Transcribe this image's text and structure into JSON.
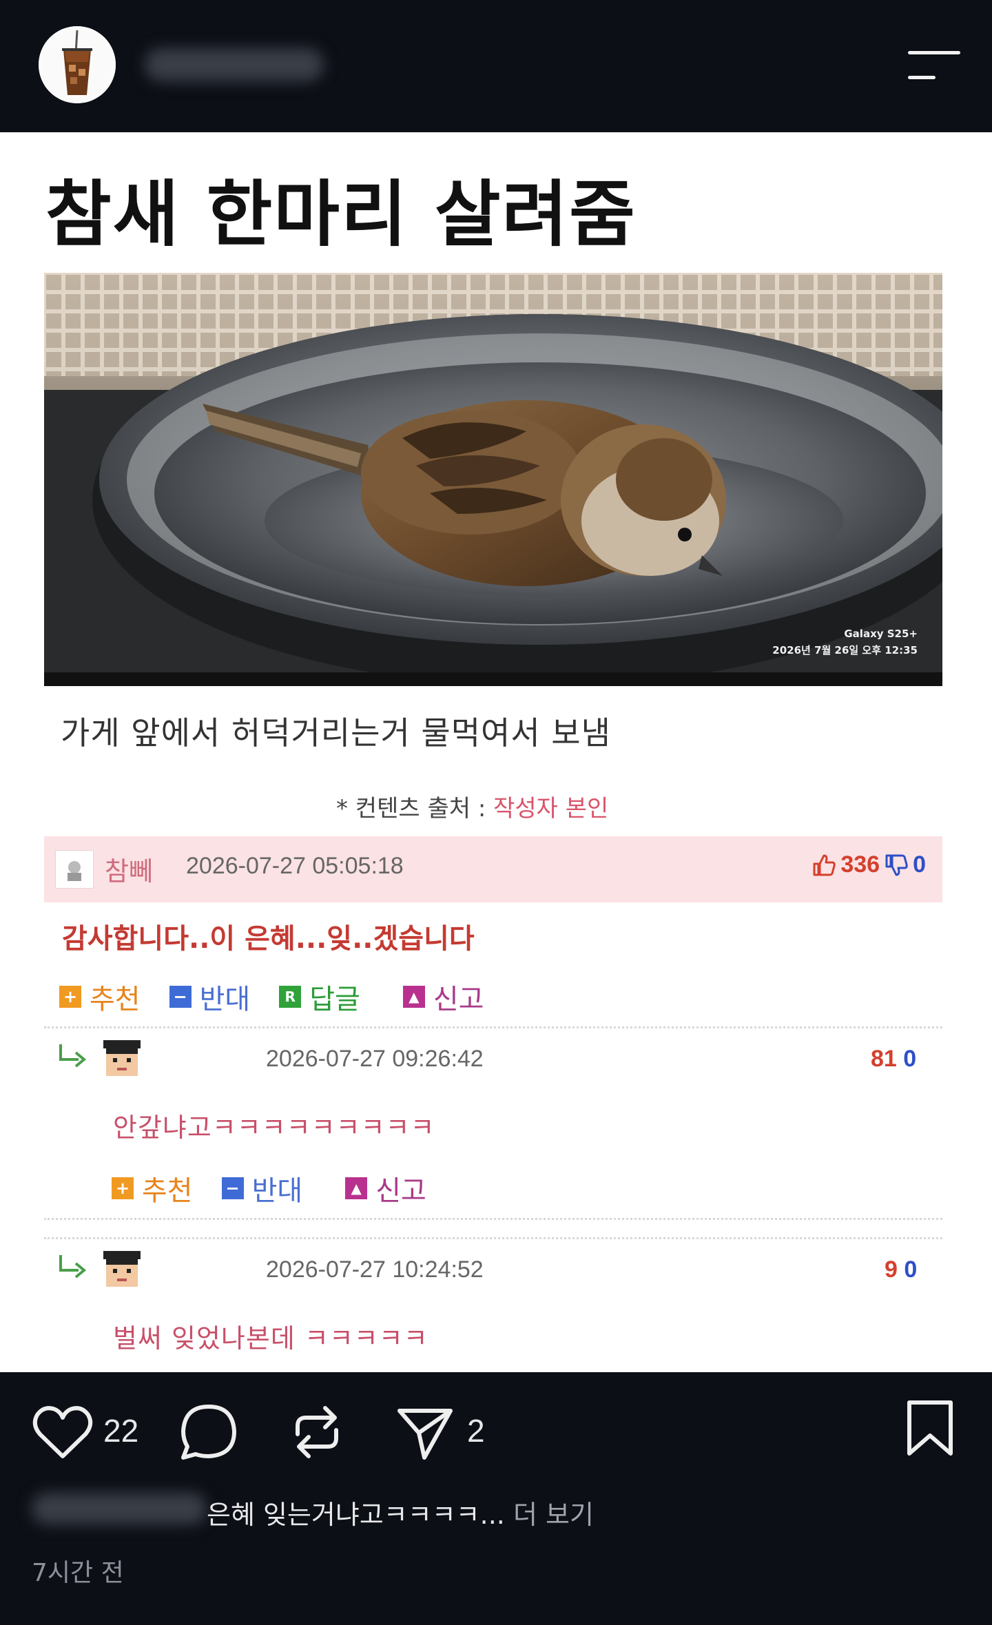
{
  "header": {
    "avatar_icon": "iced-coffee-avatar",
    "username": "",
    "menu_icon": "menu-icon"
  },
  "post": {
    "title": "참새 한마리 살려줌",
    "photo": {
      "camera": "Galaxy S25+",
      "timestamp": "2026년 7월 26일 오후 12:35"
    },
    "description": "가게 앞에서 허덕거리는거 물먹여서 보냄",
    "source_label": "* 컨텐츠 출처 : ",
    "source_value": "작성자 본인"
  },
  "comments": {
    "main": {
      "name": "참뻬",
      "date": "2026-07-27 05:05:18",
      "up": "336",
      "down": "0",
      "text": "감사합니다..이 은혜...잊..겠습니다",
      "actions": {
        "recommend": "추천",
        "oppose": "반대",
        "reply": "답글",
        "report": "신고",
        "reply_badge": "R"
      }
    },
    "replies": [
      {
        "date": "2026-07-27 09:26:42",
        "up": "81",
        "down": "0",
        "text": "안갚냐고ㅋㅋㅋㅋㅋㅋㅋㅋㅋ",
        "actions": {
          "recommend": "추천",
          "oppose": "반대",
          "report": "신고"
        }
      },
      {
        "date": "2026-07-27 10:24:52",
        "up": "9",
        "down": "0",
        "text": "벌써 잊었나본데 ㅋㅋㅋㅋㅋ"
      }
    ]
  },
  "bottom_bar": {
    "likes": "22",
    "shares": "2",
    "caption_username": "",
    "caption": "은혜 잊는거냐고ㅋㅋㅋㅋ... ",
    "more": "더 보기",
    "time": "7시간 전"
  },
  "colors": {
    "background": "#0c0f16",
    "upvote": "#d4402e",
    "downvote": "#2e4fc9",
    "comment_highlight": "#fbe2e4"
  }
}
